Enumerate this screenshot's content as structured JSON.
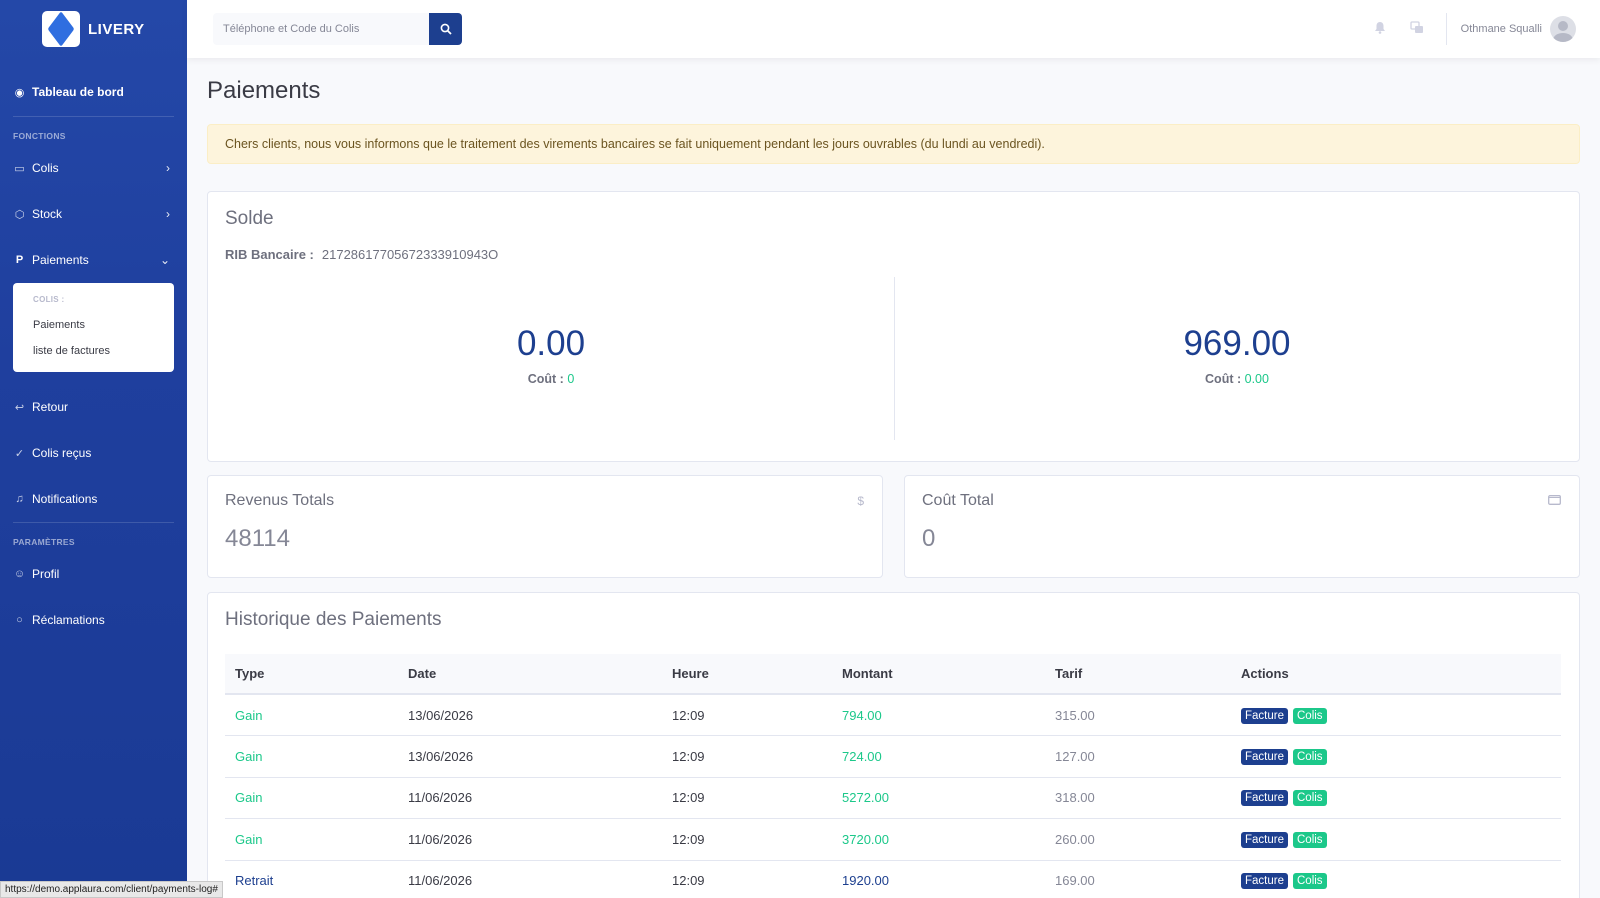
{
  "brand": {
    "name": "LIVERY"
  },
  "sidebar": {
    "dashboard": "Tableau de bord",
    "heading_fonctions": "FONCTIONS",
    "items": [
      {
        "label": "Colis",
        "icon": "box-icon"
      },
      {
        "label": "Stock",
        "icon": "cube-icon"
      },
      {
        "label": "Paiements",
        "icon": "paypal-icon"
      }
    ],
    "submenu": {
      "heading": "COLIS :",
      "items": [
        "Paiements",
        "liste de factures"
      ]
    },
    "items2": [
      {
        "label": "Retour",
        "icon": "return-icon"
      },
      {
        "label": "Colis reçus",
        "icon": "check-circle-icon"
      },
      {
        "label": "Notifications",
        "icon": "bell-icon"
      }
    ],
    "heading_parametres": "PARAMÈTRES",
    "items3": [
      {
        "label": "Profil",
        "icon": "user-circle-icon"
      },
      {
        "label": "Réclamations",
        "icon": "comment-icon"
      }
    ]
  },
  "topbar": {
    "search_placeholder": "Téléphone et Code du Colis",
    "user_name": "Othmane Squalli"
  },
  "page": {
    "title": "Paiements",
    "alert": "Chers clients, nous vous informons que le traitement des virements bancaires se fait uniquement pendant les jours ouvrables (du lundi au vendredi)."
  },
  "solde": {
    "title": "Solde",
    "rib_label": "RIB Bancaire :",
    "rib_value": "21728617705672333910943O",
    "left": {
      "amount": "0.00",
      "cost_label": "Coût :",
      "cost_value": "0"
    },
    "right": {
      "amount": "969.00",
      "cost_label": "Coût :",
      "cost_value": "0.00"
    }
  },
  "stats": {
    "revenus": {
      "title": "Revenus Totals",
      "value": "48114",
      "icon": "$"
    },
    "cout": {
      "title": "Coût Total",
      "value": "0"
    }
  },
  "history": {
    "title": "Historique des Paiements",
    "columns": [
      "Type",
      "Date",
      "Heure",
      "Montant",
      "Tarif",
      "Actions"
    ],
    "rows": [
      {
        "type": "Gain",
        "date": "13/06/2026",
        "heure": "12:09",
        "montant": "794.00",
        "tarif": "315.00"
      },
      {
        "type": "Gain",
        "date": "13/06/2026",
        "heure": "12:09",
        "montant": "724.00",
        "tarif": "127.00"
      },
      {
        "type": "Gain",
        "date": "11/06/2026",
        "heure": "12:09",
        "montant": "5272.00",
        "tarif": "318.00"
      },
      {
        "type": "Gain",
        "date": "11/06/2026",
        "heure": "12:09",
        "montant": "3720.00",
        "tarif": "260.00"
      },
      {
        "type": "Retrait",
        "date": "11/06/2026",
        "heure": "12:09",
        "montant": "1920.00",
        "tarif": "169.00"
      }
    ],
    "action_facture": "Facture",
    "action_colis": "Colis"
  },
  "status_url": "https://demo.applaura.com/client/payments-log#",
  "colors": {
    "sidebar": "#2448a8",
    "primary": "#1d3f8f",
    "success": "#1cc88a",
    "warning_bg": "#fdf4dc"
  }
}
